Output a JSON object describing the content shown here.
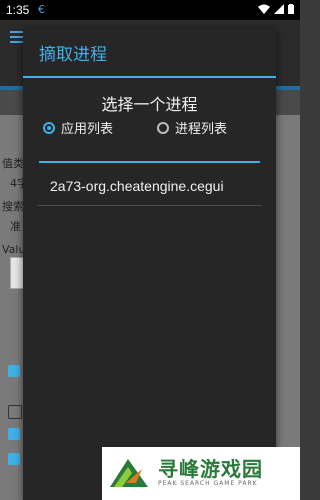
{
  "status_bar": {
    "time": "1:35",
    "app_icon": "cheat-engine-icon",
    "icons": [
      "wifi-icon",
      "signal-icon",
      "battery-icon"
    ]
  },
  "background": {
    "labels": [
      "值类",
      "4字",
      "搜索",
      "准",
      "Valu"
    ]
  },
  "dialog": {
    "title": "摘取进程",
    "prompt": "选择一个进程",
    "radio_options": [
      {
        "label": "应用列表",
        "checked": true
      },
      {
        "label": "进程列表",
        "checked": false
      }
    ],
    "search_value": "",
    "process_list": [
      "2a73-org.cheatengine.cegui"
    ]
  },
  "watermark": {
    "brand": "寻峰游戏园",
    "sub": "PEAK SEARCH GAME PARK"
  },
  "colors": {
    "accent": "#3fb0e8",
    "dialog_bg": "#262626"
  }
}
